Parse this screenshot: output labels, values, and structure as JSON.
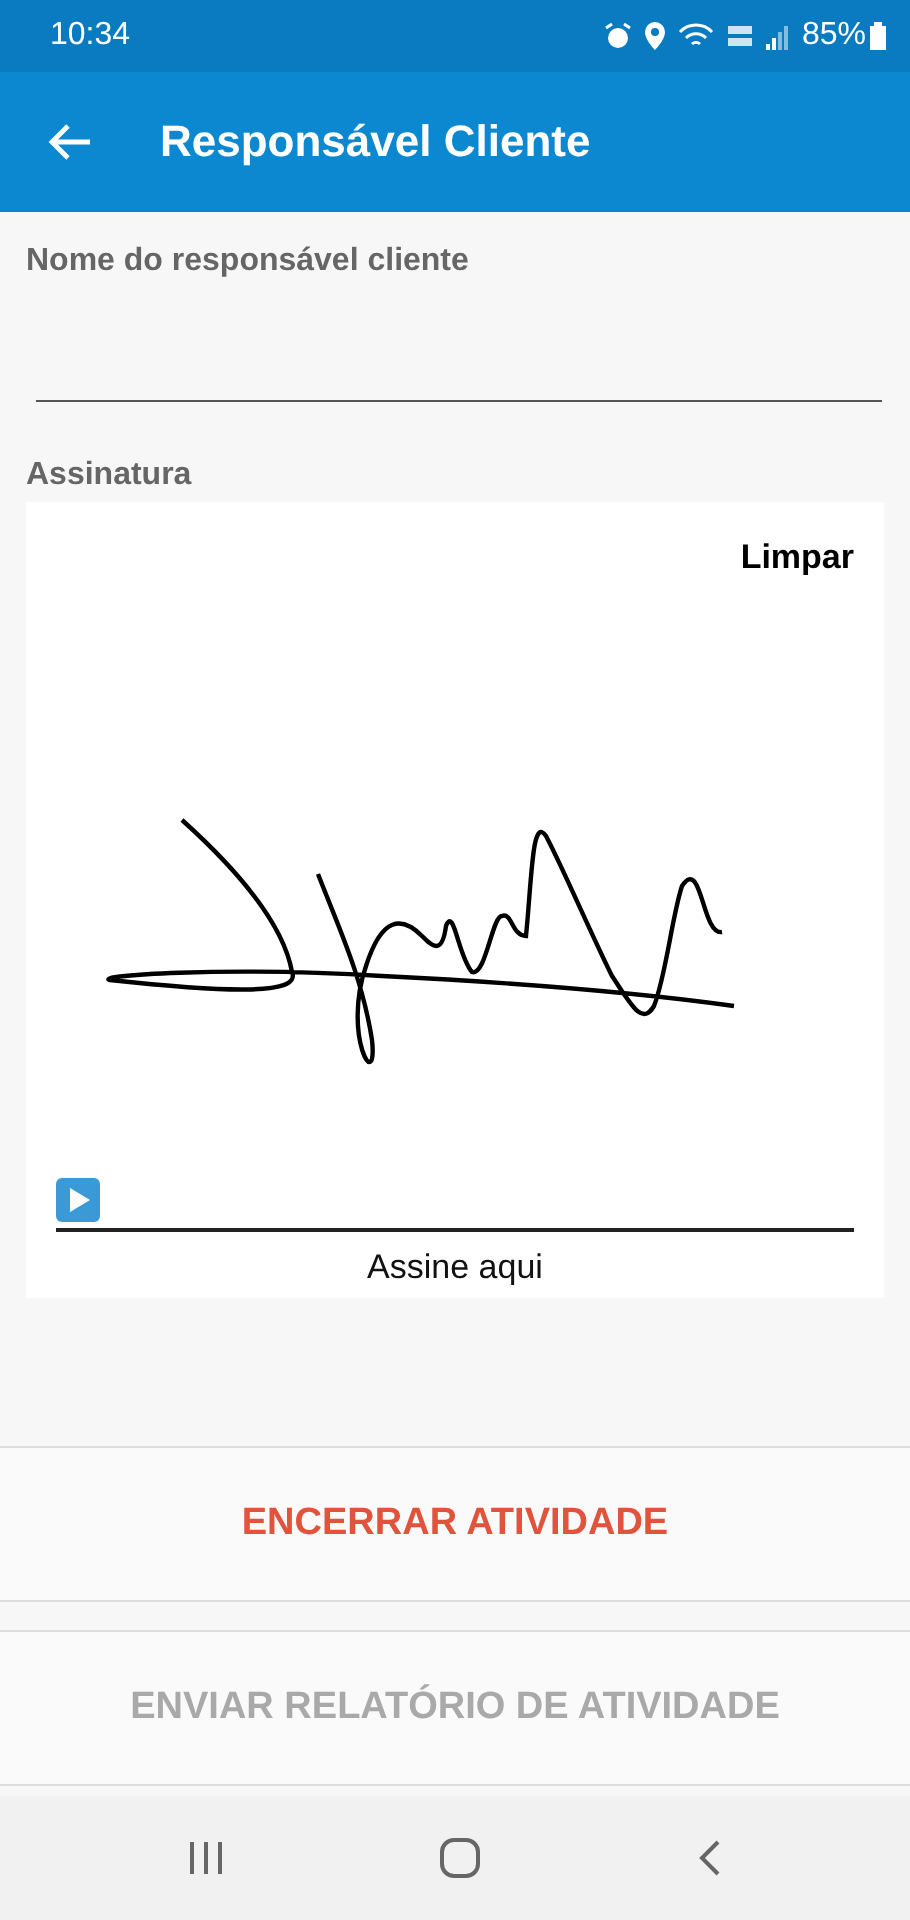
{
  "status_bar": {
    "time": "10:34",
    "battery": "85%"
  },
  "app_bar": {
    "title": "Responsável Cliente"
  },
  "name_field": {
    "label": "Nome do responsável cliente"
  },
  "signature": {
    "label": "Assinatura",
    "clear": "Limpar",
    "hint": "Assine aqui"
  },
  "buttons": [
    {
      "label": "ENCERRAR ATIVIDADE",
      "disabled": false
    },
    {
      "label": "ENVIAR RELATÓRIO DE ATIVIDADE",
      "disabled": true
    }
  ]
}
